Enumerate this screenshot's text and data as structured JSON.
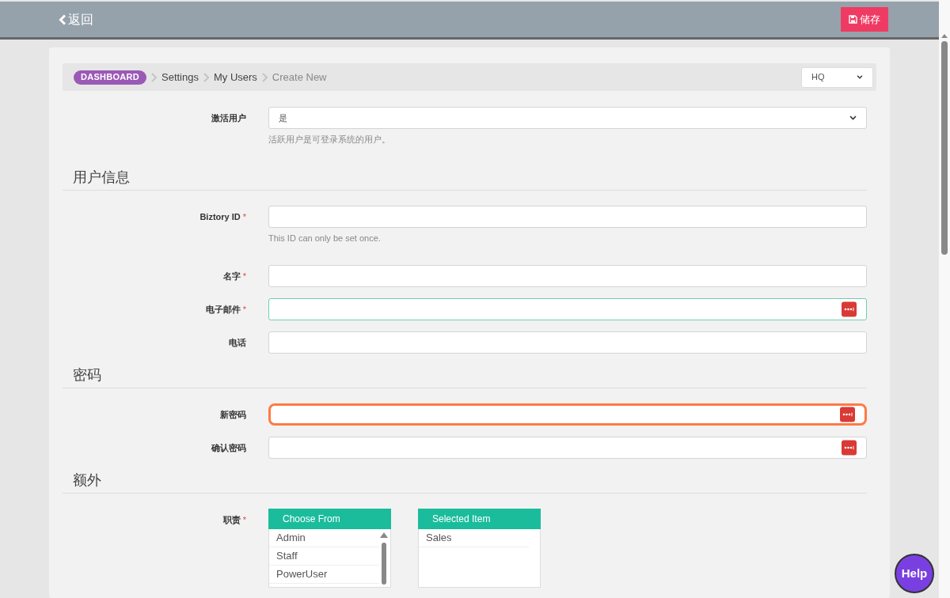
{
  "topbar": {
    "back": "返回",
    "save": "储存"
  },
  "breadcrumb": {
    "items": [
      {
        "label": "DASHBOARD",
        "kind": "badge"
      },
      {
        "label": "Settings",
        "kind": "link"
      },
      {
        "label": "My Users",
        "kind": "link"
      },
      {
        "label": "Create New",
        "kind": "current"
      }
    ],
    "branch": "HQ"
  },
  "top_fields": [
    {
      "label": "激活用户",
      "kind": "select",
      "value": "是",
      "help": "活跃用户是可登录系统的用户。",
      "valid": false,
      "focused": false
    }
  ],
  "sections": [
    {
      "title": "用户信息",
      "fields": [
        {
          "label": "Biztory ID",
          "required_mark": "*",
          "kind": "text",
          "help": "This ID can only be set once.",
          "valid": false,
          "focused": false
        },
        {
          "label": "名字",
          "required_mark": "*",
          "kind": "text",
          "valid": false,
          "focused": false
        },
        {
          "label": "电子邮件",
          "required_mark": "*",
          "kind": "password",
          "valid": true,
          "focused": false
        },
        {
          "label": "电话",
          "kind": "text",
          "valid": false,
          "focused": false
        }
      ]
    },
    {
      "title": "密码",
      "fields": [
        {
          "label": "新密码",
          "kind": "password",
          "valid": false,
          "focused": true
        },
        {
          "label": "确认密码",
          "kind": "password",
          "valid": false,
          "focused": false
        }
      ]
    },
    {
      "title": "额外"
    }
  ],
  "roles": {
    "label": "职责",
    "required_mark": "*",
    "choose": {
      "title": "Choose From",
      "items": [
        "Admin",
        "Staff",
        "PowerUser"
      ]
    },
    "selected": {
      "title": "Selected Item",
      "items": [
        "Sales"
      ]
    }
  },
  "help_button": "Help"
}
